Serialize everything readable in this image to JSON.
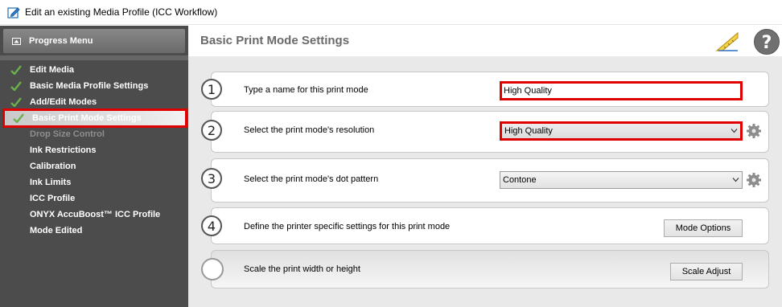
{
  "window": {
    "title": "Edit an existing Media Profile (ICC Workflow)",
    "app_icon": "edit-pencil-icon"
  },
  "sidebar": {
    "header_label": "Progress Menu",
    "items": [
      {
        "label": "Edit Media",
        "completed": true,
        "state": "normal"
      },
      {
        "label": "Basic Media Profile Settings",
        "completed": true,
        "state": "normal"
      },
      {
        "label": "Add/Edit Modes",
        "completed": true,
        "state": "normal"
      },
      {
        "label": "Basic Print Mode Settings",
        "completed": true,
        "state": "active"
      },
      {
        "label": "Drop Size Control",
        "completed": false,
        "state": "disabled"
      },
      {
        "label": "Ink Restrictions",
        "completed": false,
        "state": "normal"
      },
      {
        "label": "Calibration",
        "completed": false,
        "state": "normal"
      },
      {
        "label": "Ink Limits",
        "completed": false,
        "state": "normal"
      },
      {
        "label": "ICC Profile",
        "completed": false,
        "state": "normal"
      },
      {
        "label": "ONYX AccuBoost™ ICC Profile",
        "completed": false,
        "state": "normal"
      },
      {
        "label": "Mode Edited",
        "completed": false,
        "state": "normal"
      }
    ]
  },
  "main": {
    "title": "Basic Print Mode Settings",
    "steps": [
      {
        "number": "1",
        "label": "Type a name for this print mode",
        "input_value": "High Quality"
      },
      {
        "number": "2",
        "label": "Select the print mode's resolution",
        "select_value": "High Quality"
      },
      {
        "number": "3",
        "label": "Select the print mode's dot pattern",
        "select_value": "Contone"
      },
      {
        "number": "4",
        "label": "Define the printer specific settings for this print mode",
        "button_label": "Mode Options"
      },
      {
        "number": "",
        "label": "Scale the print width or height",
        "button_label": "Scale Adjust"
      }
    ]
  },
  "colors": {
    "highlight_red": "#e00000",
    "sidebar_bg": "#4c4c4c",
    "check_green": "#6ab04c",
    "title_gray": "#6a6a6a"
  }
}
